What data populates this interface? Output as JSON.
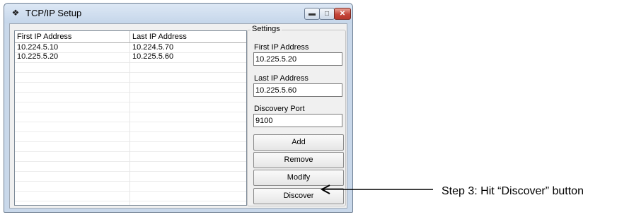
{
  "window": {
    "title": "TCP/IP Setup",
    "system_icon": "diamond-icon",
    "controls": {
      "minimize": "minimize-icon",
      "maximize": "maximize-icon",
      "close": "close-icon"
    }
  },
  "ip_list": {
    "columns": [
      "First IP Address",
      "Last IP Address"
    ],
    "rows": [
      [
        "10.224.5.10",
        "10.224.5.70"
      ],
      [
        "10.225.5.20",
        "10.225.5.60"
      ]
    ]
  },
  "settings": {
    "group_label": "Settings",
    "first_ip": {
      "label": "First IP Address",
      "value": "10.225.5.20"
    },
    "last_ip": {
      "label": "Last IP Address",
      "value": "10.225.5.60"
    },
    "discovery_port": {
      "label": "Discovery Port",
      "value": "9100"
    },
    "buttons": {
      "add": "Add",
      "remove": "Remove",
      "modify": "Modify",
      "discover": "Discover"
    }
  },
  "annotation": {
    "text": "Step 3: Hit “Discover” button",
    "arrow_icon": "left-arrow-icon"
  }
}
